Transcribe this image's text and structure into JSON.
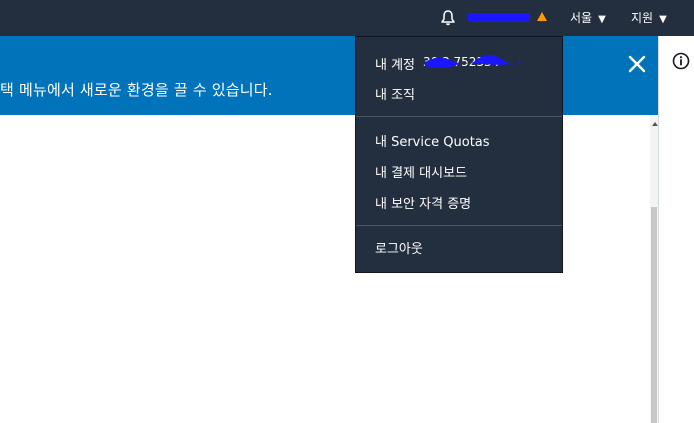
{
  "topbar": {
    "bell_icon": "bell-icon",
    "warning_icon": "warning-triangle-icon",
    "region_label": "서울",
    "support_label": "지원",
    "caret": "▼"
  },
  "banner": {
    "message": "택 메뉴에서 새로운 환경을 끌 수 있습니다.",
    "close_icon": "close-icon",
    "color": "#0073bb"
  },
  "dropdown": {
    "account_label": "내 계정",
    "account_id_visible_fragment": "30 3 752334",
    "organization_label": "내 조직",
    "service_quotas_label": "내 Service Quotas",
    "billing_dashboard_label": "내 결제 대시보드",
    "security_credentials_label": "내 보안 자격 증명",
    "sign_out_label": "로그아웃"
  },
  "right_panel": {
    "info_icon": "info-icon"
  },
  "colors": {
    "topbar_bg": "#232f3e",
    "banner_bg": "#0073bb",
    "warning_orange": "#ff9900",
    "redaction_blue": "#1a16ff"
  }
}
